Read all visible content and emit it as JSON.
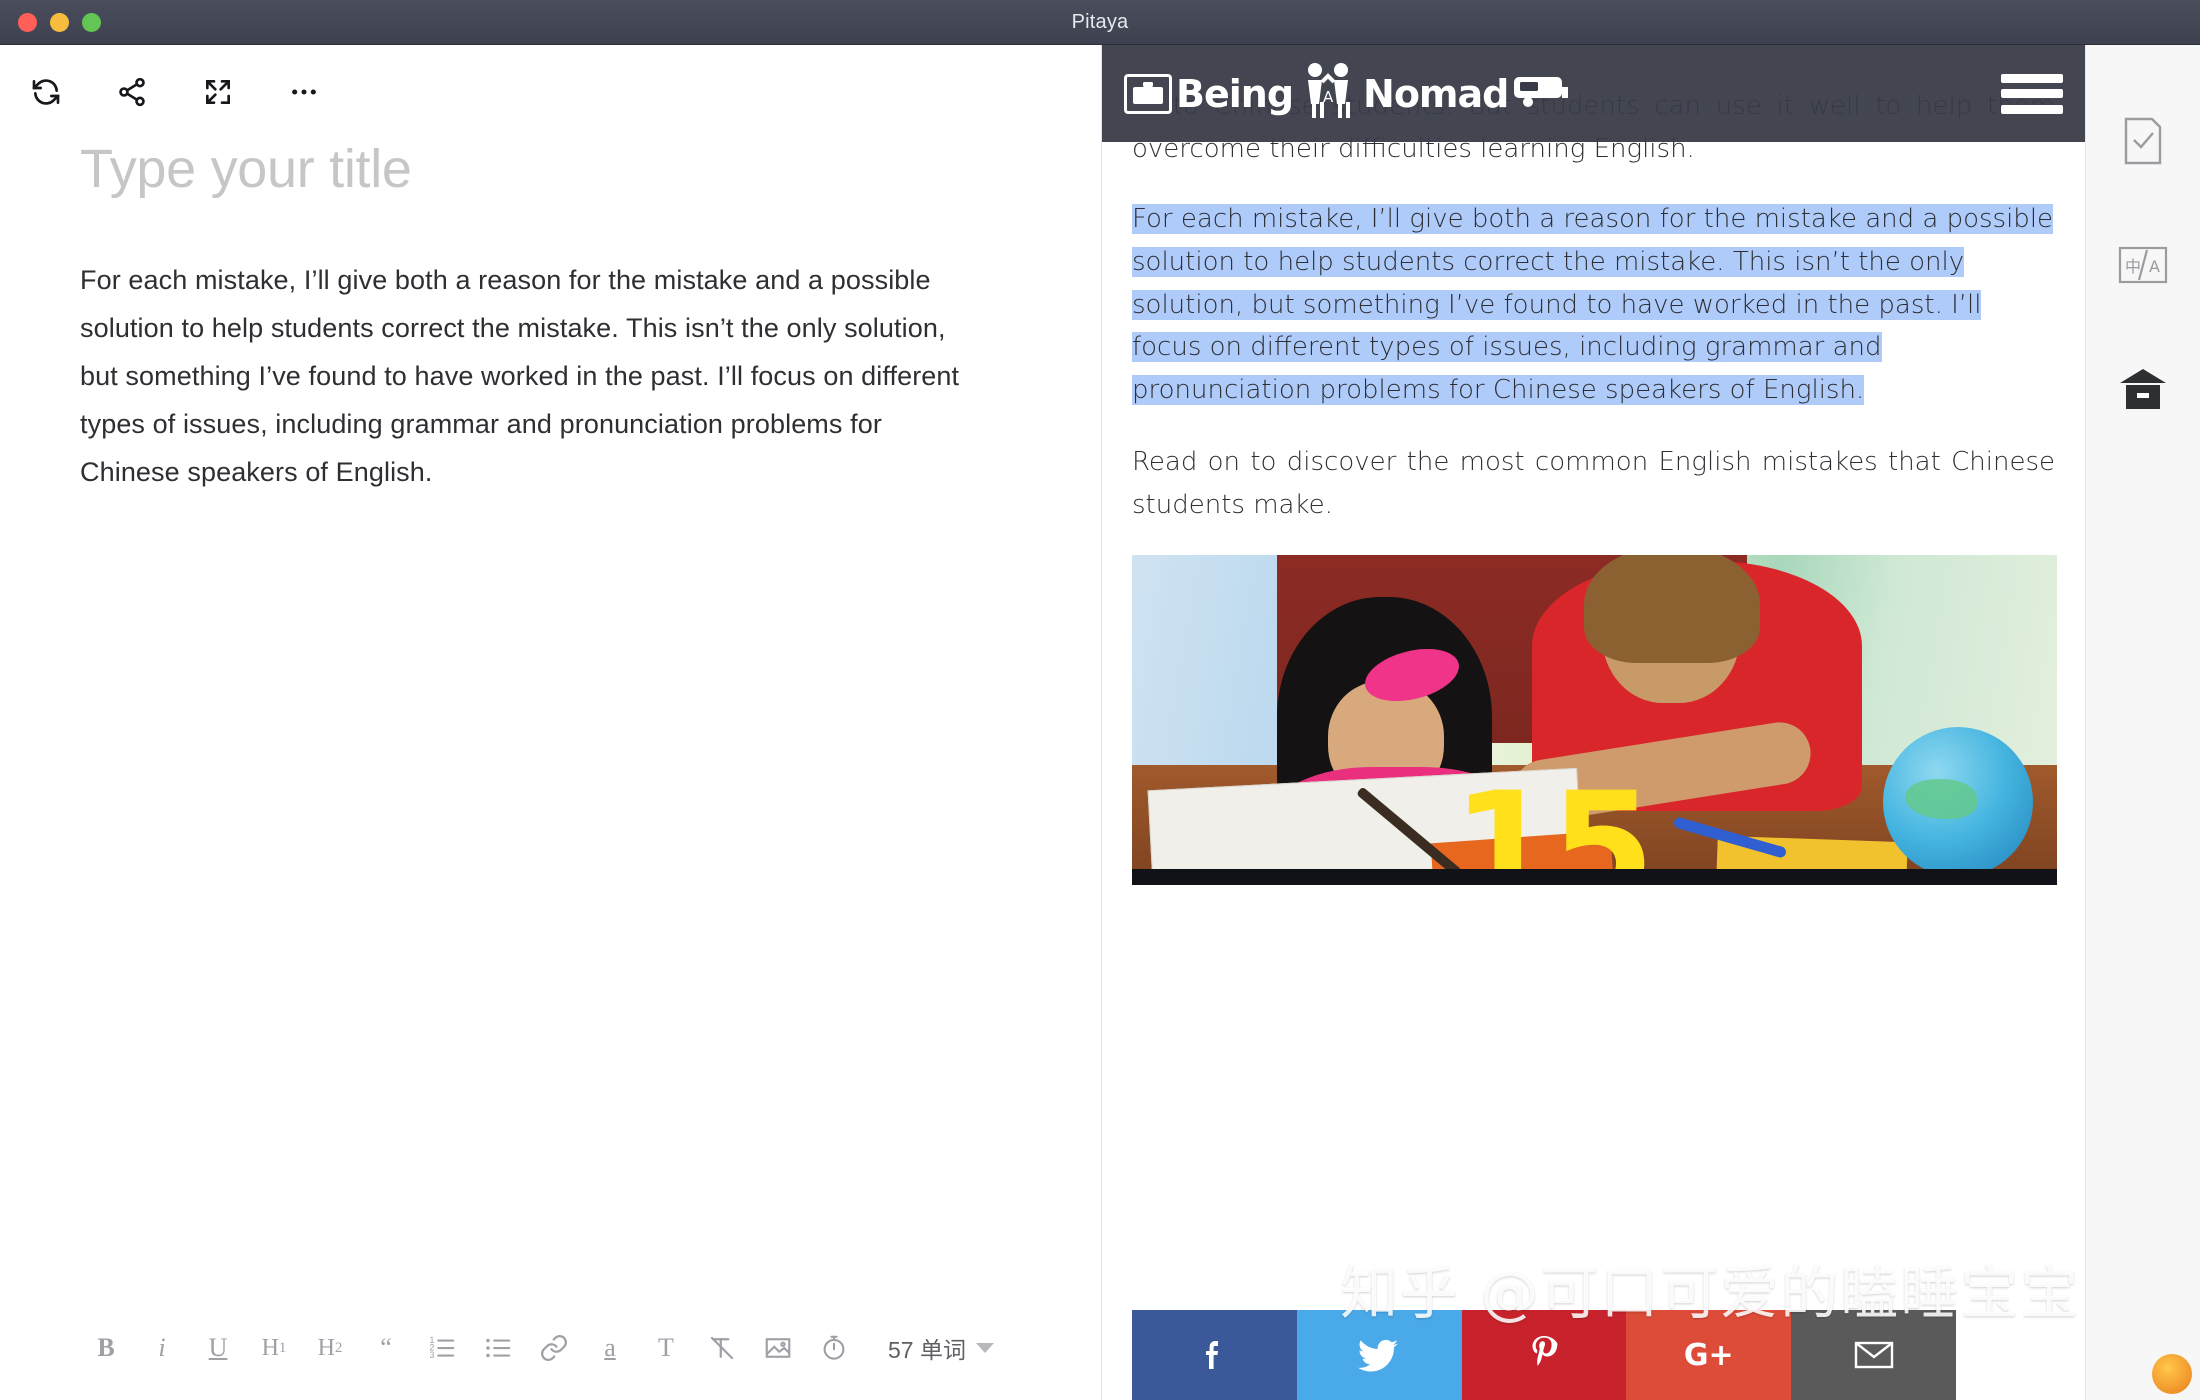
{
  "window": {
    "title": "Pitaya",
    "traffic_lights": [
      "close-red",
      "minimize-yellow",
      "maximize-green"
    ]
  },
  "editor_toolbar": {
    "items": [
      {
        "name": "sync-icon",
        "label": "Sync"
      },
      {
        "name": "share-icon",
        "label": "Share"
      },
      {
        "name": "fullscreen-icon",
        "label": "Fullscreen"
      },
      {
        "name": "more-icon",
        "label": "More"
      }
    ]
  },
  "editor": {
    "title_placeholder": "Type your title",
    "body": "For each mistake, I’ll give both a reason for the mistake and a possible solution to help students correct the mistake. This isn’t the only solution, but something I’ve found to have worked in the past. I’ll focus on different types of issues, including grammar and pronunciation problems for Chinese speakers of English."
  },
  "format_bar": {
    "buttons": [
      {
        "name": "bold-button",
        "label": "B"
      },
      {
        "name": "italic-button",
        "label": "i"
      },
      {
        "name": "underline-button",
        "label": "U"
      },
      {
        "name": "heading1-button",
        "label": "H",
        "sub": "1"
      },
      {
        "name": "heading2-button",
        "label": "H",
        "sub": "2"
      },
      {
        "name": "blockquote-button",
        "label": "“"
      },
      {
        "name": "ordered-list-button",
        "label": ""
      },
      {
        "name": "bullet-list-button",
        "label": ""
      },
      {
        "name": "link-button",
        "label": ""
      },
      {
        "name": "highlight-button",
        "label": "a"
      },
      {
        "name": "text-style-button",
        "label": "T"
      },
      {
        "name": "clear-format-button",
        "label": "T"
      },
      {
        "name": "image-button",
        "label": ""
      },
      {
        "name": "timer-button",
        "label": ""
      }
    ],
    "word_count": "57 单词"
  },
  "preview": {
    "site_logo": {
      "text_one": "Being",
      "text_two": "Nomad",
      "middle": "A"
    },
    "menu_label": "Menu",
    "paragraph_top": "… to Chinese students. But students can use it well to help them overcome their difficulties learning English.",
    "paragraph_selected": "For each mistake, I’ll give both a reason for the mistake and a possible solution to help students correct the mistake. This isn’t the only solution, but something I’ve found to have worked in the past. I’ll focus on different types of issues, including grammar and pronunciation problems for Chinese speakers of English.",
    "paragraph_after": "Read on to discover the most common English mistakes that Chinese students make.",
    "photo": {
      "caption_number": "15",
      "alt": "Teacher in red shirt helping a young girl with schoolwork at a desk with a globe and notebooks"
    },
    "social": [
      {
        "name": "facebook-share-button",
        "glyph": "f",
        "color": "#3b5998"
      },
      {
        "name": "twitter-share-button",
        "glyph": "t",
        "color": "#4aa9e8"
      },
      {
        "name": "pinterest-share-button",
        "glyph": "P",
        "color": "#c8232c"
      },
      {
        "name": "googleplus-share-button",
        "glyph": "G+",
        "color": "#dd4b39"
      },
      {
        "name": "email-share-button",
        "glyph": "✉",
        "color": "#5a5a5a"
      }
    ]
  },
  "right_rail": {
    "items": [
      {
        "name": "proofread-icon",
        "label": "Proofread"
      },
      {
        "name": "translate-icon",
        "label": "中/A"
      },
      {
        "name": "archive-icon",
        "label": "Archive"
      }
    ]
  },
  "watermark": {
    "text": "知乎 @可口可爱的瞌睡宝宝"
  },
  "colors": {
    "titlebar": "#3e4150",
    "selection": "#aecbfa",
    "site_header": "#373a46",
    "rail_bg": "#f7f7f8"
  }
}
